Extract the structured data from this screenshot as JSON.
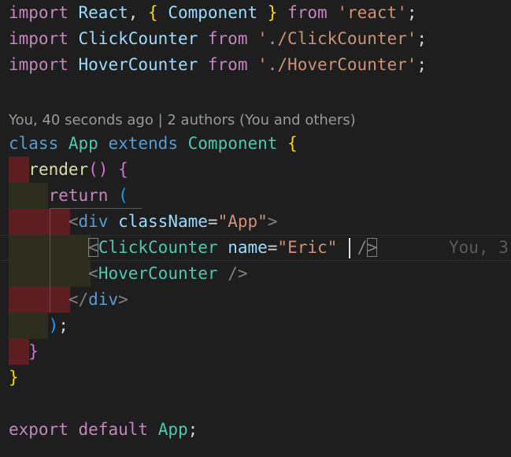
{
  "editor": {
    "language": "javascript",
    "codelens": "You, 40 seconds ago | 2 authors (You and others)",
    "inline_blame": "You, 3",
    "lines": [
      {
        "tokens": [
          {
            "t": "import",
            "c": "k-purple"
          },
          {
            "t": " ",
            "c": "k-plain"
          },
          {
            "t": "React",
            "c": "k-ident"
          },
          {
            "t": ", ",
            "c": "k-plain"
          },
          {
            "t": "{",
            "c": "k-br1"
          },
          {
            "t": " ",
            "c": "k-plain"
          },
          {
            "t": "Component",
            "c": "k-ident"
          },
          {
            "t": " ",
            "c": "k-plain"
          },
          {
            "t": "}",
            "c": "k-br1"
          },
          {
            "t": " ",
            "c": "k-plain"
          },
          {
            "t": "from",
            "c": "k-purple"
          },
          {
            "t": " ",
            "c": "k-plain"
          },
          {
            "t": "'react'",
            "c": "k-str"
          },
          {
            "t": ";",
            "c": "k-plain"
          }
        ]
      },
      {
        "tokens": [
          {
            "t": "import",
            "c": "k-purple"
          },
          {
            "t": " ",
            "c": "k-plain"
          },
          {
            "t": "ClickCounter",
            "c": "k-ident"
          },
          {
            "t": " ",
            "c": "k-plain"
          },
          {
            "t": "from",
            "c": "k-purple"
          },
          {
            "t": " ",
            "c": "k-plain"
          },
          {
            "t": "'./ClickCounter'",
            "c": "k-str"
          },
          {
            "t": ";",
            "c": "k-plain"
          }
        ]
      },
      {
        "tokens": [
          {
            "t": "import",
            "c": "k-purple"
          },
          {
            "t": " ",
            "c": "k-plain"
          },
          {
            "t": "HoverCounter",
            "c": "k-ident"
          },
          {
            "t": " ",
            "c": "k-plain"
          },
          {
            "t": "from",
            "c": "k-purple"
          },
          {
            "t": " ",
            "c": "k-plain"
          },
          {
            "t": "'./HoverCounter'",
            "c": "k-str"
          },
          {
            "t": ";",
            "c": "k-plain"
          }
        ]
      },
      {
        "tokens": []
      },
      {
        "tokens": [
          {
            "t": "class",
            "c": "k-blue"
          },
          {
            "t": " ",
            "c": "k-plain"
          },
          {
            "t": "App",
            "c": "k-class"
          },
          {
            "t": " ",
            "c": "k-plain"
          },
          {
            "t": "extends",
            "c": "k-blue"
          },
          {
            "t": " ",
            "c": "k-plain"
          },
          {
            "t": "Component",
            "c": "k-class"
          },
          {
            "t": " ",
            "c": "k-plain"
          },
          {
            "t": "{",
            "c": "k-br1"
          }
        ]
      },
      {
        "tokens": [
          {
            "t": "  ",
            "c": "k-plain"
          },
          {
            "t": "render",
            "c": "k-func"
          },
          {
            "t": "()",
            "c": "k-br2"
          },
          {
            "t": " ",
            "c": "k-plain"
          },
          {
            "t": "{",
            "c": "k-br2"
          }
        ]
      },
      {
        "tokens": [
          {
            "t": "    ",
            "c": "k-plain"
          },
          {
            "t": "return",
            "c": "k-purple"
          },
          {
            "t": " ",
            "c": "k-plain"
          },
          {
            "t": "(",
            "c": "k-br3"
          }
        ]
      },
      {
        "tokens": [
          {
            "t": "      ",
            "c": "k-plain"
          },
          {
            "t": "<",
            "c": "k-gray"
          },
          {
            "t": "div",
            "c": "k-blue"
          },
          {
            "t": " ",
            "c": "k-plain"
          },
          {
            "t": "className",
            "c": "k-ident"
          },
          {
            "t": "=",
            "c": "k-plain"
          },
          {
            "t": "\"App\"",
            "c": "k-str"
          },
          {
            "t": ">",
            "c": "k-gray"
          }
        ]
      },
      {
        "tokens": [
          {
            "t": "        ",
            "c": "k-plain"
          },
          {
            "t": "<",
            "c": "k-gray",
            "box": true
          },
          {
            "t": "ClickCounter",
            "c": "k-class"
          },
          {
            "t": " ",
            "c": "k-plain"
          },
          {
            "t": "name",
            "c": "k-ident"
          },
          {
            "t": "=",
            "c": "k-plain"
          },
          {
            "t": "\"Eric\"",
            "c": "k-str"
          },
          {
            "t": "  ",
            "c": "k-plain"
          },
          {
            "t": "/",
            "c": "k-gray"
          },
          {
            "t": ">",
            "c": "k-gray",
            "box": true
          }
        ]
      },
      {
        "tokens": [
          {
            "t": "        ",
            "c": "k-plain"
          },
          {
            "t": "<",
            "c": "k-gray"
          },
          {
            "t": "HoverCounter",
            "c": "k-class"
          },
          {
            "t": " ",
            "c": "k-plain"
          },
          {
            "t": "/>",
            "c": "k-gray"
          }
        ]
      },
      {
        "tokens": [
          {
            "t": "      ",
            "c": "k-plain"
          },
          {
            "t": "</",
            "c": "k-gray"
          },
          {
            "t": "div",
            "c": "k-blue"
          },
          {
            "t": ">",
            "c": "k-gray"
          }
        ]
      },
      {
        "tokens": [
          {
            "t": "    ",
            "c": "k-plain"
          },
          {
            "t": ")",
            "c": "k-br3"
          },
          {
            "t": ";",
            "c": "k-plain"
          }
        ]
      },
      {
        "tokens": [
          {
            "t": "  ",
            "c": "k-plain"
          },
          {
            "t": "}",
            "c": "k-br2"
          }
        ]
      },
      {
        "tokens": [
          {
            "t": "}",
            "c": "k-br1"
          }
        ]
      },
      {
        "tokens": []
      },
      {
        "tokens": [
          {
            "t": "export",
            "c": "k-purple"
          },
          {
            "t": " ",
            "c": "k-plain"
          },
          {
            "t": "default",
            "c": "k-purple"
          },
          {
            "t": " ",
            "c": "k-plain"
          },
          {
            "t": "App",
            "c": "k-class"
          },
          {
            "t": ";",
            "c": "k-plain"
          }
        ]
      }
    ]
  }
}
